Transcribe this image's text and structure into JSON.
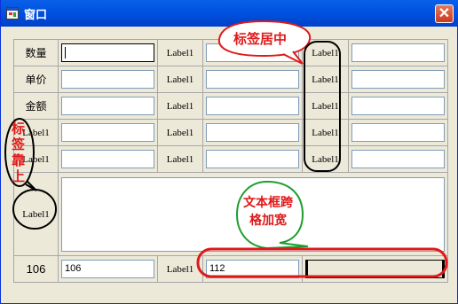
{
  "window": {
    "title": "窗口"
  },
  "rows": [
    {
      "label": "数量",
      "input1": "",
      "mid_label": "Label1",
      "input2": "",
      "right_label": "Label1",
      "input3": ""
    },
    {
      "label": "单价",
      "input1": "",
      "mid_label": "Label1",
      "input2": "",
      "right_label": "Label1",
      "input3": ""
    },
    {
      "label": "金额",
      "input1": "",
      "mid_label": "Label1",
      "input2": "",
      "right_label": "Label1",
      "input3": ""
    },
    {
      "label": "Label1",
      "input1": "",
      "mid_label": "Label1",
      "input2": "",
      "right_label": "Label1",
      "input3": ""
    },
    {
      "label": "Label1",
      "input1": "",
      "mid_label": "Label1",
      "input2": "",
      "right_label": "Label1",
      "input3": ""
    }
  ],
  "big_row": {
    "label": "Label1",
    "textarea": ""
  },
  "bottom_row": {
    "label": "106",
    "input1": "106",
    "mid_label": "Label1",
    "input_wide": "112"
  },
  "annotations": {
    "center_label": "标签居中",
    "top_label": [
      "标",
      "签",
      "靠",
      "上"
    ],
    "span_widen": [
      "文本框跨",
      "格加宽"
    ]
  },
  "colors": {
    "annotation_red": "#E01818",
    "annotation_green": "#1E9E2E"
  }
}
